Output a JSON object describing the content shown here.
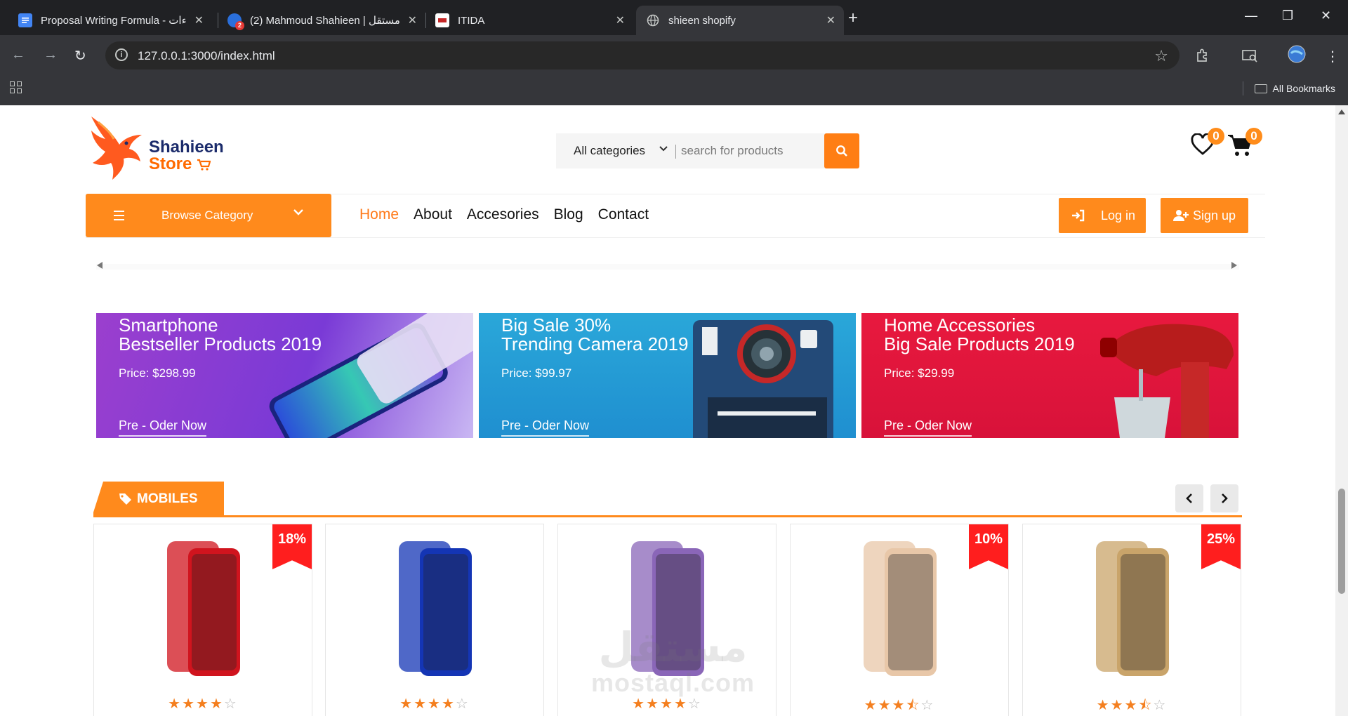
{
  "browser": {
    "tabs": [
      {
        "title": "Proposal Writing Formula - ءات",
        "active": false
      },
      {
        "title": "(2) Mahmoud Shahieen | مستقل",
        "active": false
      },
      {
        "title": "ITIDA",
        "active": false
      },
      {
        "title": "shieen shopify",
        "active": true
      }
    ],
    "favicon_badge": "2",
    "url": "127.0.0.1:3000/index.html",
    "all_bookmarks": "All Bookmarks"
  },
  "header": {
    "logo": {
      "line1": "Shahieen",
      "line2": "Store"
    },
    "search": {
      "category": "All categories",
      "placeholder": "search for products"
    },
    "wishlist_count": "0",
    "cart_count": "0"
  },
  "nav": {
    "browse_label": "Browse Category",
    "items": [
      "Home",
      "About",
      "Accesories",
      "Blog",
      "Contact"
    ],
    "login": "Log in",
    "signup": "Sign up"
  },
  "banners": [
    {
      "line1": "Smartphone",
      "line2": "Bestseller Products 2019",
      "price": "Price: $298.99",
      "cta": "Pre - Oder Now"
    },
    {
      "line1": "Big Sale 30%",
      "line2": "Trending Camera 2019",
      "price": "Price: $99.97",
      "cta": "Pre - Oder Now"
    },
    {
      "line1": "Home Accessories",
      "line2": "Big Sale Products 2019",
      "price": "Price: $29.99",
      "cta": "Pre - Oder Now"
    }
  ],
  "mobiles": {
    "title": "MOBILES",
    "products": [
      {
        "discount": "18%",
        "rating": 4,
        "color": "#d0141e"
      },
      {
        "discount": "",
        "rating": 4,
        "color": "#1435b5"
      },
      {
        "discount": "",
        "rating": 4,
        "color": "#8a66b8"
      },
      {
        "discount": "10%",
        "rating": 3.5,
        "color": "#e8c7a8"
      },
      {
        "discount": "25%",
        "rating": 3.5,
        "color": "#c9a46a"
      }
    ]
  },
  "watermark": {
    "arabic": "مستقل",
    "latin": "mostaql.com"
  },
  "colors": {
    "accent": "#ff8a1c",
    "ribbon": "#ff1e1e",
    "star": "#f47f1f"
  }
}
